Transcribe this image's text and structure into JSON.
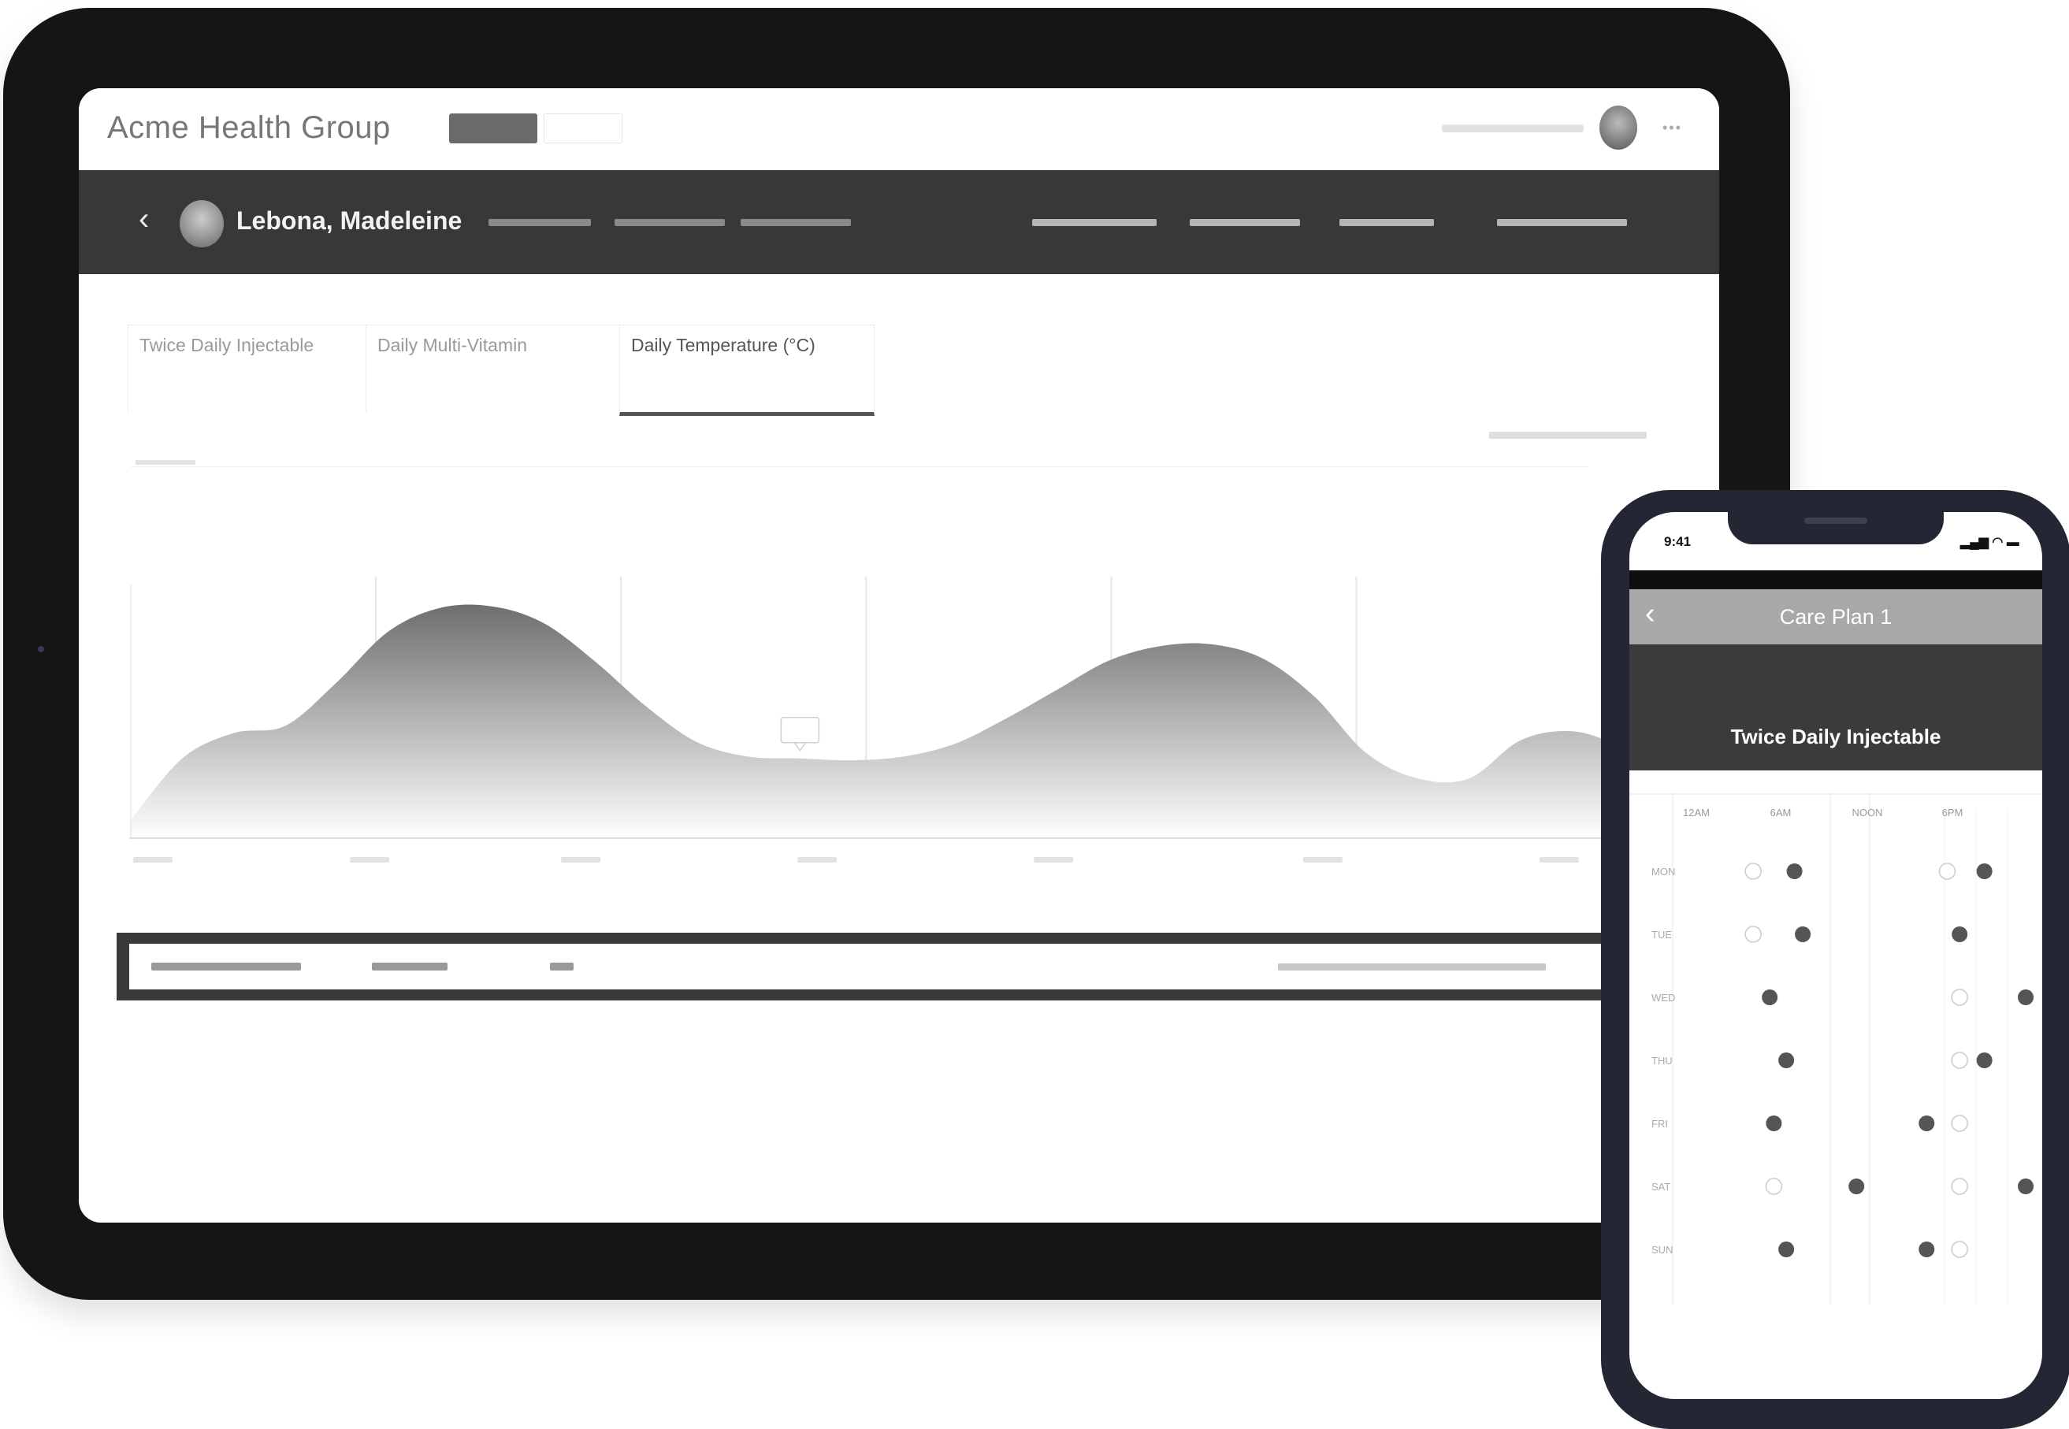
{
  "tablet": {
    "org_name": "Acme Health Group",
    "tag_primary": "",
    "tag_secondary": "",
    "patient": {
      "back_icon": "‹",
      "name": "Lebona, Madeleine"
    },
    "tabs": [
      {
        "title": "Twice Daily Injectable",
        "sub": "",
        "detail": ""
      },
      {
        "title": "Daily Multi-Vitamin",
        "sub": "",
        "detail": ""
      },
      {
        "title": "Daily Temperature (°C)",
        "sub": "",
        "detail": ""
      }
    ],
    "chart_panel": {
      "date_range": "",
      "tooltip_value": "",
      "x_labels": []
    }
  },
  "chart_data": {
    "type": "area",
    "title": "",
    "xlabel": "",
    "ylabel": "",
    "x": [
      0,
      1,
      2,
      3,
      4,
      5,
      6,
      7,
      8,
      9,
      10,
      11,
      12,
      13,
      14,
      15,
      16,
      17,
      18,
      19,
      20,
      21,
      22,
      23,
      24,
      25,
      26,
      27,
      28,
      29,
      30
    ],
    "y": [
      10,
      44,
      58,
      62,
      86,
      114,
      127,
      128,
      119,
      98,
      73,
      53,
      45,
      44,
      43,
      45,
      52,
      66,
      82,
      98,
      106,
      107,
      99,
      78,
      47,
      33,
      33,
      54,
      59,
      51,
      44
    ],
    "ylim": [
      0,
      140
    ],
    "grid": true,
    "tooltip_index": 13
  },
  "phone": {
    "time": "9:41",
    "status_carrier": "",
    "status_time": "",
    "status_battery": "",
    "nav_back_icon": "‹",
    "nav_title": "Care Plan 1",
    "hero_title": "Twice Daily Injectable",
    "week_label": "",
    "columns": [
      "12AM",
      "6AM",
      "NOON",
      "6PM"
    ],
    "days": [
      "MON",
      "TUE",
      "WED",
      "THU",
      "FRI",
      "SAT",
      "SUN"
    ],
    "schedule": [
      [
        [
          "o",
          0.3
        ],
        [
          "f",
          0.4
        ],
        [
          "o",
          0.77
        ],
        [
          "f",
          0.86
        ]
      ],
      [
        [
          "o",
          0.3
        ],
        [
          "f",
          0.42
        ],
        [
          "f",
          0.8
        ]
      ],
      [
        [
          "f",
          0.34
        ],
        [
          "o",
          0.8
        ],
        [
          "f",
          0.96
        ]
      ],
      [
        [
          "f",
          0.38
        ],
        [
          "o",
          0.8
        ],
        [
          "f",
          0.86
        ]
      ],
      [
        [
          "f",
          0.35
        ],
        [
          "f",
          0.72
        ],
        [
          "o",
          0.8
        ]
      ],
      [
        [
          "o",
          0.35
        ],
        [
          "f",
          0.55
        ],
        [
          "o",
          0.8
        ],
        [
          "f",
          0.96
        ]
      ],
      [
        [
          "f",
          0.38
        ],
        [
          "f",
          0.72
        ],
        [
          "o",
          0.8
        ]
      ]
    ]
  }
}
